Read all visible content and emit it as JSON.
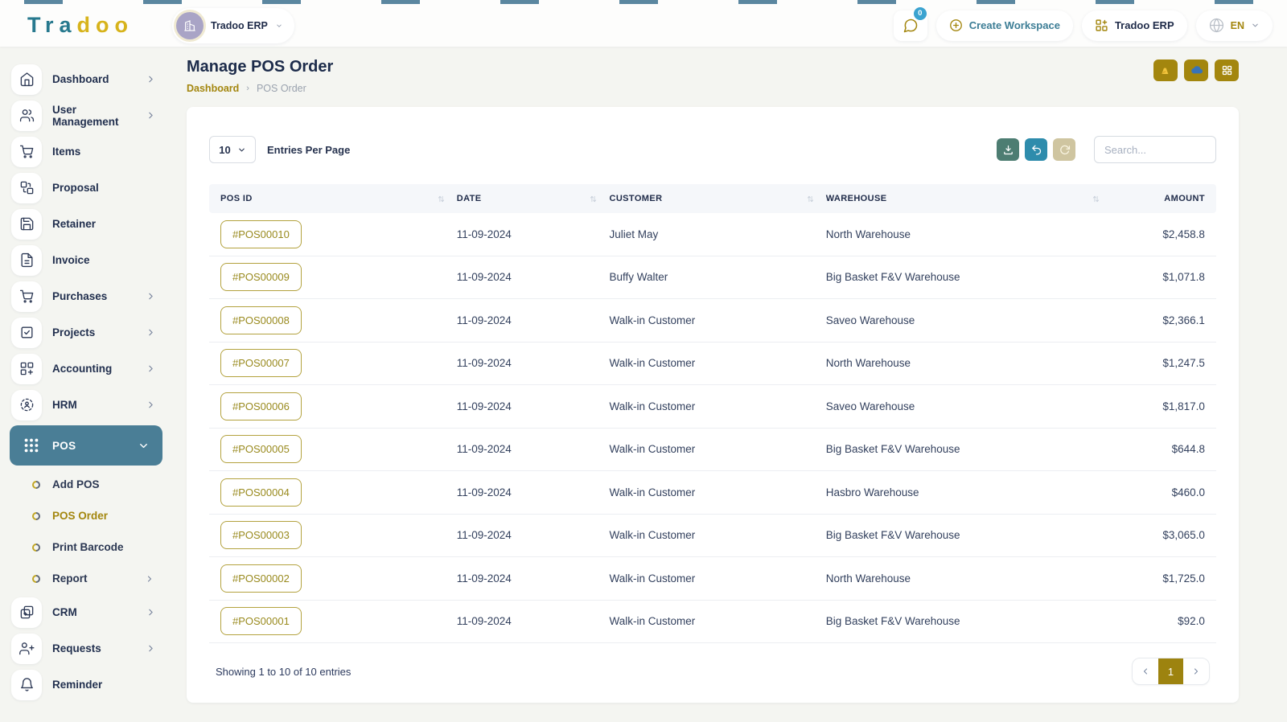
{
  "brand": {
    "logo_teal": "Tra",
    "logo_gold": "doo"
  },
  "workspace_pill": {
    "label": "Tradoo ERP"
  },
  "header_actions": {
    "chat_badge": "0",
    "create_workspace_label": "Create Workspace",
    "erp_switcher_label": "Tradoo ERP",
    "language_label": "EN"
  },
  "page_header": {
    "title": "Manage POS Order",
    "breadcrumb_home": "Dashboard",
    "breadcrumb_current": "POS Order"
  },
  "sidebar": {
    "items": [
      {
        "label": "Dashboard"
      },
      {
        "label": "User Management"
      },
      {
        "label": "Items"
      },
      {
        "label": "Proposal"
      },
      {
        "label": "Retainer"
      },
      {
        "label": "Invoice"
      },
      {
        "label": "Purchases"
      },
      {
        "label": "Projects"
      },
      {
        "label": "Accounting"
      },
      {
        "label": "HRM"
      },
      {
        "label": "POS"
      }
    ],
    "pos_submenu": [
      {
        "label": "Add POS"
      },
      {
        "label": "POS Order"
      },
      {
        "label": "Print Barcode"
      },
      {
        "label": "Report"
      }
    ],
    "items_after": [
      {
        "label": "CRM"
      },
      {
        "label": "Requests"
      },
      {
        "label": "Reminder"
      }
    ]
  },
  "toolbar": {
    "entries_value": "10",
    "entries_label": "Entries Per Page",
    "search_placeholder": "Search..."
  },
  "table": {
    "columns": [
      "POS ID",
      "DATE",
      "CUSTOMER",
      "WAREHOUSE",
      "AMOUNT"
    ],
    "rows": [
      {
        "id": "#POS00010",
        "date": "11-09-2024",
        "customer": "Juliet May",
        "warehouse": "North Warehouse",
        "amount": "$2,458.8"
      },
      {
        "id": "#POS00009",
        "date": "11-09-2024",
        "customer": "Buffy Walter",
        "warehouse": "Big Basket F&V Warehouse",
        "amount": "$1,071.8"
      },
      {
        "id": "#POS00008",
        "date": "11-09-2024",
        "customer": "Walk-in Customer",
        "warehouse": "Saveo Warehouse",
        "amount": "$2,366.1"
      },
      {
        "id": "#POS00007",
        "date": "11-09-2024",
        "customer": "Walk-in Customer",
        "warehouse": "North Warehouse",
        "amount": "$1,247.5"
      },
      {
        "id": "#POS00006",
        "date": "11-09-2024",
        "customer": "Walk-in Customer",
        "warehouse": "Saveo Warehouse",
        "amount": "$1,817.0"
      },
      {
        "id": "#POS00005",
        "date": "11-09-2024",
        "customer": "Walk-in Customer",
        "warehouse": "Big Basket F&V Warehouse",
        "amount": "$644.8"
      },
      {
        "id": "#POS00004",
        "date": "11-09-2024",
        "customer": "Walk-in Customer",
        "warehouse": "Hasbro Warehouse",
        "amount": "$460.0"
      },
      {
        "id": "#POS00003",
        "date": "11-09-2024",
        "customer": "Walk-in Customer",
        "warehouse": "Big Basket F&V Warehouse",
        "amount": "$3,065.0"
      },
      {
        "id": "#POS00002",
        "date": "11-09-2024",
        "customer": "Walk-in Customer",
        "warehouse": "North Warehouse",
        "amount": "$1,725.0"
      },
      {
        "id": "#POS00001",
        "date": "11-09-2024",
        "customer": "Walk-in Customer",
        "warehouse": "Big Basket F&V Warehouse",
        "amount": "$92.0"
      }
    ]
  },
  "footer": {
    "showing_text": "Showing 1 to 10 of 10 entries",
    "current_page": "1"
  },
  "colors": {
    "accent_gold": "#a3860e",
    "active_sidebar_teal": "#4a7e96",
    "brand_teal": "#27798e",
    "brand_gold": "#d7b31b",
    "download_button": "#4d7d72",
    "undo_button": "#2e8cac",
    "refresh_button": "#cfc5a0",
    "chat_badge_blue": "#3ba3d0"
  }
}
